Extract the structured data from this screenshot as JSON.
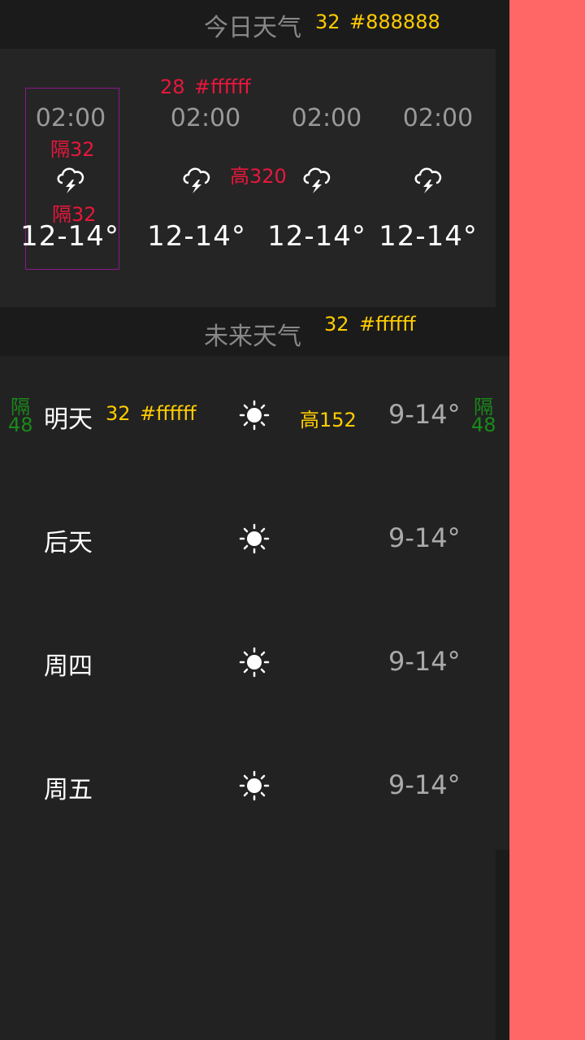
{
  "today_section": {
    "title": "今日天气",
    "annot_size": "32",
    "annot_color": "#888888"
  },
  "today_panel": {
    "annot_size": "28",
    "annot_color": "#ffffff",
    "spacing_label_top": "隔32",
    "spacing_label_bottom": "隔32",
    "height_label": "高320",
    "hours": [
      {
        "time": "02:00",
        "icon": "thunderstorm-icon",
        "temp": "12-14°"
      },
      {
        "time": "02:00",
        "icon": "thunderstorm-icon",
        "temp": "12-14°"
      },
      {
        "time": "02:00",
        "icon": "thunderstorm-icon",
        "temp": "12-14°"
      },
      {
        "time": "02:00",
        "icon": "thunderstorm-icon",
        "temp": "12-14°"
      }
    ]
  },
  "future_section": {
    "title": "未来天气",
    "annot_size": "32",
    "annot_color": "#ffffff"
  },
  "future_panel": {
    "row_annot_size": "32",
    "row_annot_color": "#ffffff",
    "height_label": "高152",
    "spacing_left": "隔48",
    "spacing_right": "隔48",
    "days": [
      {
        "label": "明天",
        "icon": "sun-icon",
        "temp": "9-14°"
      },
      {
        "label": "后天",
        "icon": "sun-icon",
        "temp": "9-14°"
      },
      {
        "label": "周四",
        "icon": "sun-icon",
        "temp": "9-14°"
      },
      {
        "label": "周五",
        "icon": "sun-icon",
        "temp": "9-14°"
      }
    ]
  },
  "colors": {
    "background": "#222222",
    "header": "#1b1b1b",
    "accent_strip": "#ff6666",
    "annot_yellow": "#ffcc00",
    "annot_red": "#e8173c",
    "annot_green": "#1a8a1a"
  }
}
